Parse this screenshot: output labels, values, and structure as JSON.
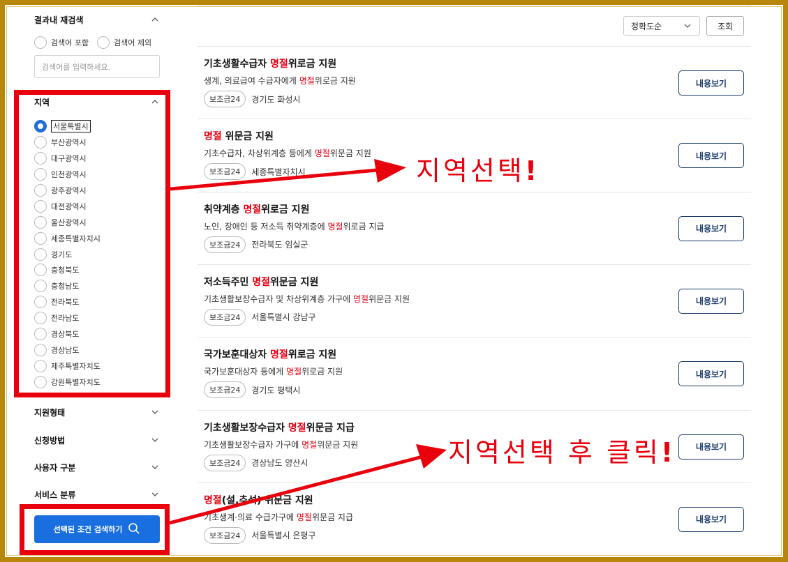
{
  "sidebar": {
    "refine": {
      "title": "결과내 재검색",
      "include_label": "검색어 포함",
      "exclude_label": "검색어 제외",
      "placeholder": "검색어를 입력하세요."
    },
    "region": {
      "title": "지역",
      "selected": "서울특별시",
      "items": [
        "서울특별시",
        "부산광역시",
        "대구광역시",
        "인천광역시",
        "광주광역시",
        "대전광역시",
        "울산광역시",
        "세종특별자치시",
        "경기도",
        "충청북도",
        "충청남도",
        "전라북도",
        "전라남도",
        "경상북도",
        "경상남도",
        "제주특별자치도",
        "강원특별자치도"
      ]
    },
    "filters": [
      "지원형태",
      "신청방법",
      "사용자 구분",
      "서비스 분류"
    ],
    "search_button": "선택된 조건 검색하기"
  },
  "main": {
    "sort": "정확도순",
    "query_button": "조회",
    "detail_label": "내용보기",
    "results": [
      {
        "title_pre": "기초생활수급자 ",
        "title_hl": "명절",
        "title_post": "위로금 지원",
        "desc_pre": "생계, 의료급여 수급자에게 ",
        "desc_hl": "명절",
        "desc_post": "위로금 지원",
        "badge": "보조금24",
        "location": "경기도 화성시"
      },
      {
        "title_pre": "",
        "title_hl": "명절",
        "title_post": " 위문금 지원",
        "desc_pre": "기초수급자, 차상위계층 등에게 ",
        "desc_hl": "명절",
        "desc_post": "위문금 지원",
        "badge": "보조금24",
        "location": "세종특별자치시"
      },
      {
        "title_pre": "취약계층 ",
        "title_hl": "명절",
        "title_post": "위로금 지원",
        "desc_pre": "노인, 장애인 등 저소득 취약계층에 ",
        "desc_hl": "명절",
        "desc_post": "위로금 지급",
        "badge": "보조금24",
        "location": "전라북도 임실군"
      },
      {
        "title_pre": "저소득주민 ",
        "title_hl": "명절",
        "title_post": "위문금 지원",
        "desc_pre": "기초생활보장수급자 및 차상위계층 가구에 ",
        "desc_hl": "명절",
        "desc_post": "위문금 지원",
        "badge": "보조금24",
        "location": "서울특별시 강남구"
      },
      {
        "title_pre": "국가보훈대상자 ",
        "title_hl": "명절",
        "title_post": "위로금 지원",
        "desc_pre": "국가보훈대상자 등에게 ",
        "desc_hl": "명절",
        "desc_post": "위로금 지원",
        "badge": "보조금24",
        "location": "경기도 평택시"
      },
      {
        "title_pre": "기초생활보장수급자 ",
        "title_hl": "명절",
        "title_post": "위문금 지급",
        "desc_pre": "기초생활보장수급자 가구에 ",
        "desc_hl": "명절",
        "desc_post": "위문금 지원",
        "badge": "보조금24",
        "location": "경상남도 양산시"
      },
      {
        "title_pre": "",
        "title_hl": "명절",
        "title_post": "(설,추석) 위문금 지원",
        "desc_pre": "기초생계·의료 수급가구에 ",
        "desc_hl": "명절",
        "desc_post": "위문금 지급",
        "badge": "보조금24",
        "location": "서울특별시 은평구"
      }
    ]
  },
  "annotations": {
    "region_select": "지역선택",
    "click_after": "지역선택 후 클릭",
    "bang": "!"
  },
  "colors": {
    "annotation_red": "#e8000d",
    "primary_blue": "#1a6fe0",
    "highlight_red": "#e60012",
    "frame_gold": "#b8860b"
  }
}
